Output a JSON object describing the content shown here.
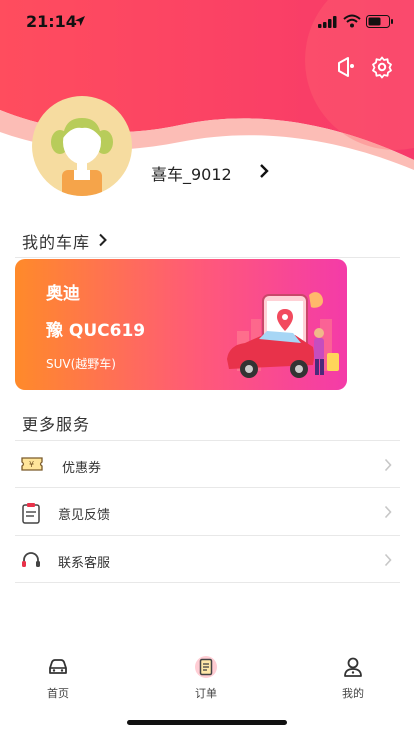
{
  "status_bar": {
    "time": "21:14"
  },
  "profile": {
    "username": "喜车_9012"
  },
  "garage": {
    "title": "我的车库",
    "car": {
      "brand": "奥迪",
      "plate": "豫 QUC619",
      "type": "SUV(越野车)"
    }
  },
  "services": {
    "title": "更多服务",
    "items": [
      {
        "label": "优惠券",
        "icon": "coupon-icon"
      },
      {
        "label": "意见反馈",
        "icon": "feedback-icon"
      },
      {
        "label": "联系客服",
        "icon": "headset-icon"
      }
    ]
  },
  "tabbar": {
    "items": [
      {
        "label": "首页",
        "icon": "car-icon"
      },
      {
        "label": "订单",
        "icon": "order-icon"
      },
      {
        "label": "我的",
        "icon": "user-icon"
      }
    ]
  },
  "colors": {
    "accent": "#f7436a",
    "gradient_start": "#ff8a2a",
    "gradient_end": "#f43ba8"
  }
}
